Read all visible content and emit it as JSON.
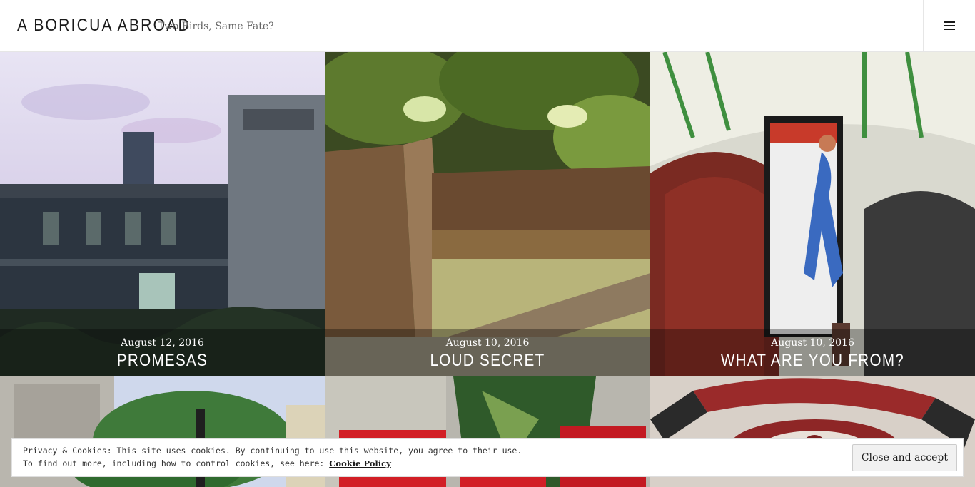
{
  "header": {
    "site_title": "A BORICUA ABROAD",
    "tagline": "Two Birds, Same Fate?",
    "menu_icon": "hamburger-icon"
  },
  "posts": [
    {
      "date": "August 12, 2016",
      "title": "PROMESAS"
    },
    {
      "date": "August 10, 2016",
      "title": "LOUD SECRET"
    },
    {
      "date": "August 10, 2016",
      "title": "WHAT ARE YOU FROM?"
    }
  ],
  "cookie_banner": {
    "line1": "Privacy & Cookies: This site uses cookies. By continuing to use this website, you agree to their use.",
    "line2_prefix": "To find out more, including how to control cookies, see here: ",
    "link_text": "Cookie Policy",
    "button_label": "Close and accept"
  }
}
